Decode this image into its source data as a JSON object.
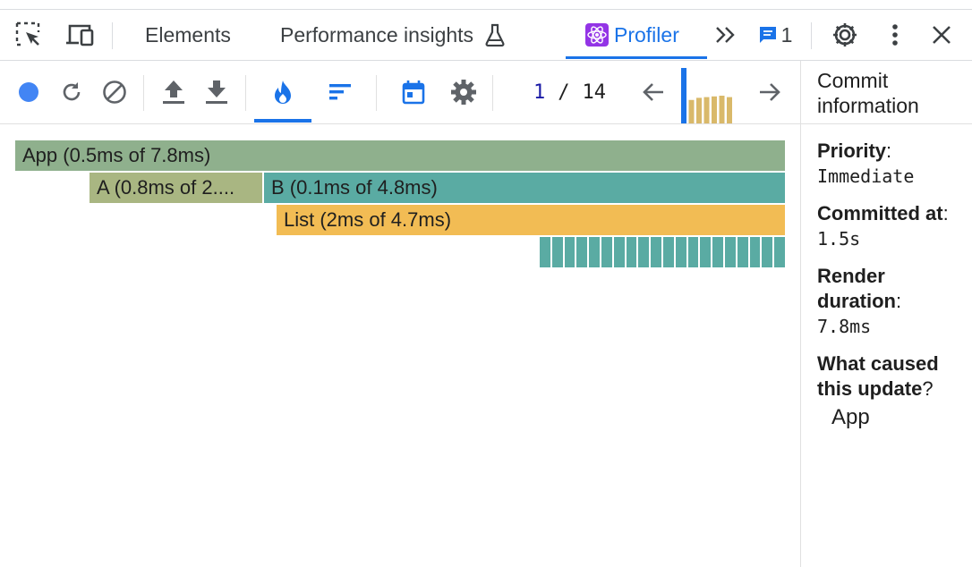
{
  "tabbar": {
    "tabs": [
      {
        "label": "Elements"
      },
      {
        "label": "Performance insights"
      },
      {
        "label": "Profiler"
      }
    ],
    "messages_count": "1"
  },
  "toolbar": {
    "commit_current": "1",
    "commit_separator": "/",
    "commit_total": "14",
    "commit_durations_ms": [
      7.8,
      3.3,
      3.6,
      3.7,
      3.8,
      3.9,
      3.7
    ],
    "selected_commit_index": 0
  },
  "flamegraph": {
    "frames": [
      {
        "label": "App (0.5ms of 7.8ms)",
        "color": "#8fb08d"
      },
      {
        "label": "A (0.8ms of 2....",
        "color": "#a9b682"
      },
      {
        "label": "B (0.1ms of 4.8ms)",
        "color": "#5aaba3"
      },
      {
        "label": "List (2ms of 4.7ms)",
        "color": "#f2bc54"
      }
    ],
    "list_items_count": 20,
    "list_item_color": "#5aaba3"
  },
  "sidebar": {
    "title": "Commit information",
    "priority_label": "Priority",
    "priority_value": "Immediate",
    "committed_label": "Committed at",
    "committed_value": "1.5s",
    "render_label": "Render duration",
    "render_value": "7.8ms",
    "cause_label": "What caused this update",
    "cause_value": "App"
  },
  "colors": {
    "accent": "#1a73e8",
    "record": "#4285f4",
    "commit_bar": "#d9b96a"
  }
}
